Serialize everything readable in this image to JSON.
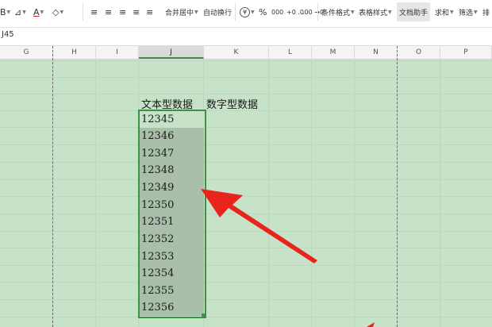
{
  "toolbar": {
    "items": [
      {
        "id": "font-b",
        "label": "B"
      },
      {
        "id": "fill",
        "label": "⊿"
      },
      {
        "id": "fontcolor",
        "label": "A"
      },
      {
        "id": "eraser",
        "label": "◇"
      },
      {
        "id": "al1",
        "label": "≡"
      },
      {
        "id": "al2",
        "label": "≡"
      },
      {
        "id": "al3",
        "label": "≡"
      },
      {
        "id": "al4",
        "label": "≡"
      },
      {
        "id": "al5",
        "label": "≡"
      },
      {
        "id": "merge",
        "label": "合并居中"
      },
      {
        "id": "wrap",
        "label": "自动换行"
      },
      {
        "id": "currency",
        "label": "¥"
      },
      {
        "id": "percent",
        "label": "%"
      },
      {
        "id": "thousand",
        "label": "000"
      },
      {
        "id": "incdec",
        "label": "+0 .0"
      },
      {
        "id": "decdec",
        "label": ".00 →0"
      },
      {
        "id": "condfmt",
        "label": "条件格式"
      },
      {
        "id": "tablestyle",
        "label": "表格样式"
      },
      {
        "id": "dochelper",
        "label": "文档助手"
      },
      {
        "id": "sum",
        "label": "求和"
      },
      {
        "id": "filter",
        "label": "筛选"
      },
      {
        "id": "more",
        "label": "排"
      }
    ]
  },
  "formula_bar": {
    "name_box": "J45"
  },
  "columns": [
    "G",
    "H",
    "I",
    "J",
    "K",
    "L",
    "M",
    "N",
    "O",
    "P"
  ],
  "selected_column": "J",
  "headers": {
    "text_col": "文本型数据",
    "number_col": "数字型数据"
  },
  "values": [
    "12345",
    "12346",
    "12347",
    "12348",
    "12349",
    "12350",
    "12351",
    "12352",
    "12353",
    "12354",
    "12355",
    "12356"
  ],
  "colors": {
    "sheet_bg": "#c6e2c8",
    "selection": "#a9bfaa",
    "selection_border": "#3e9140",
    "arrow": "#e8241c"
  }
}
